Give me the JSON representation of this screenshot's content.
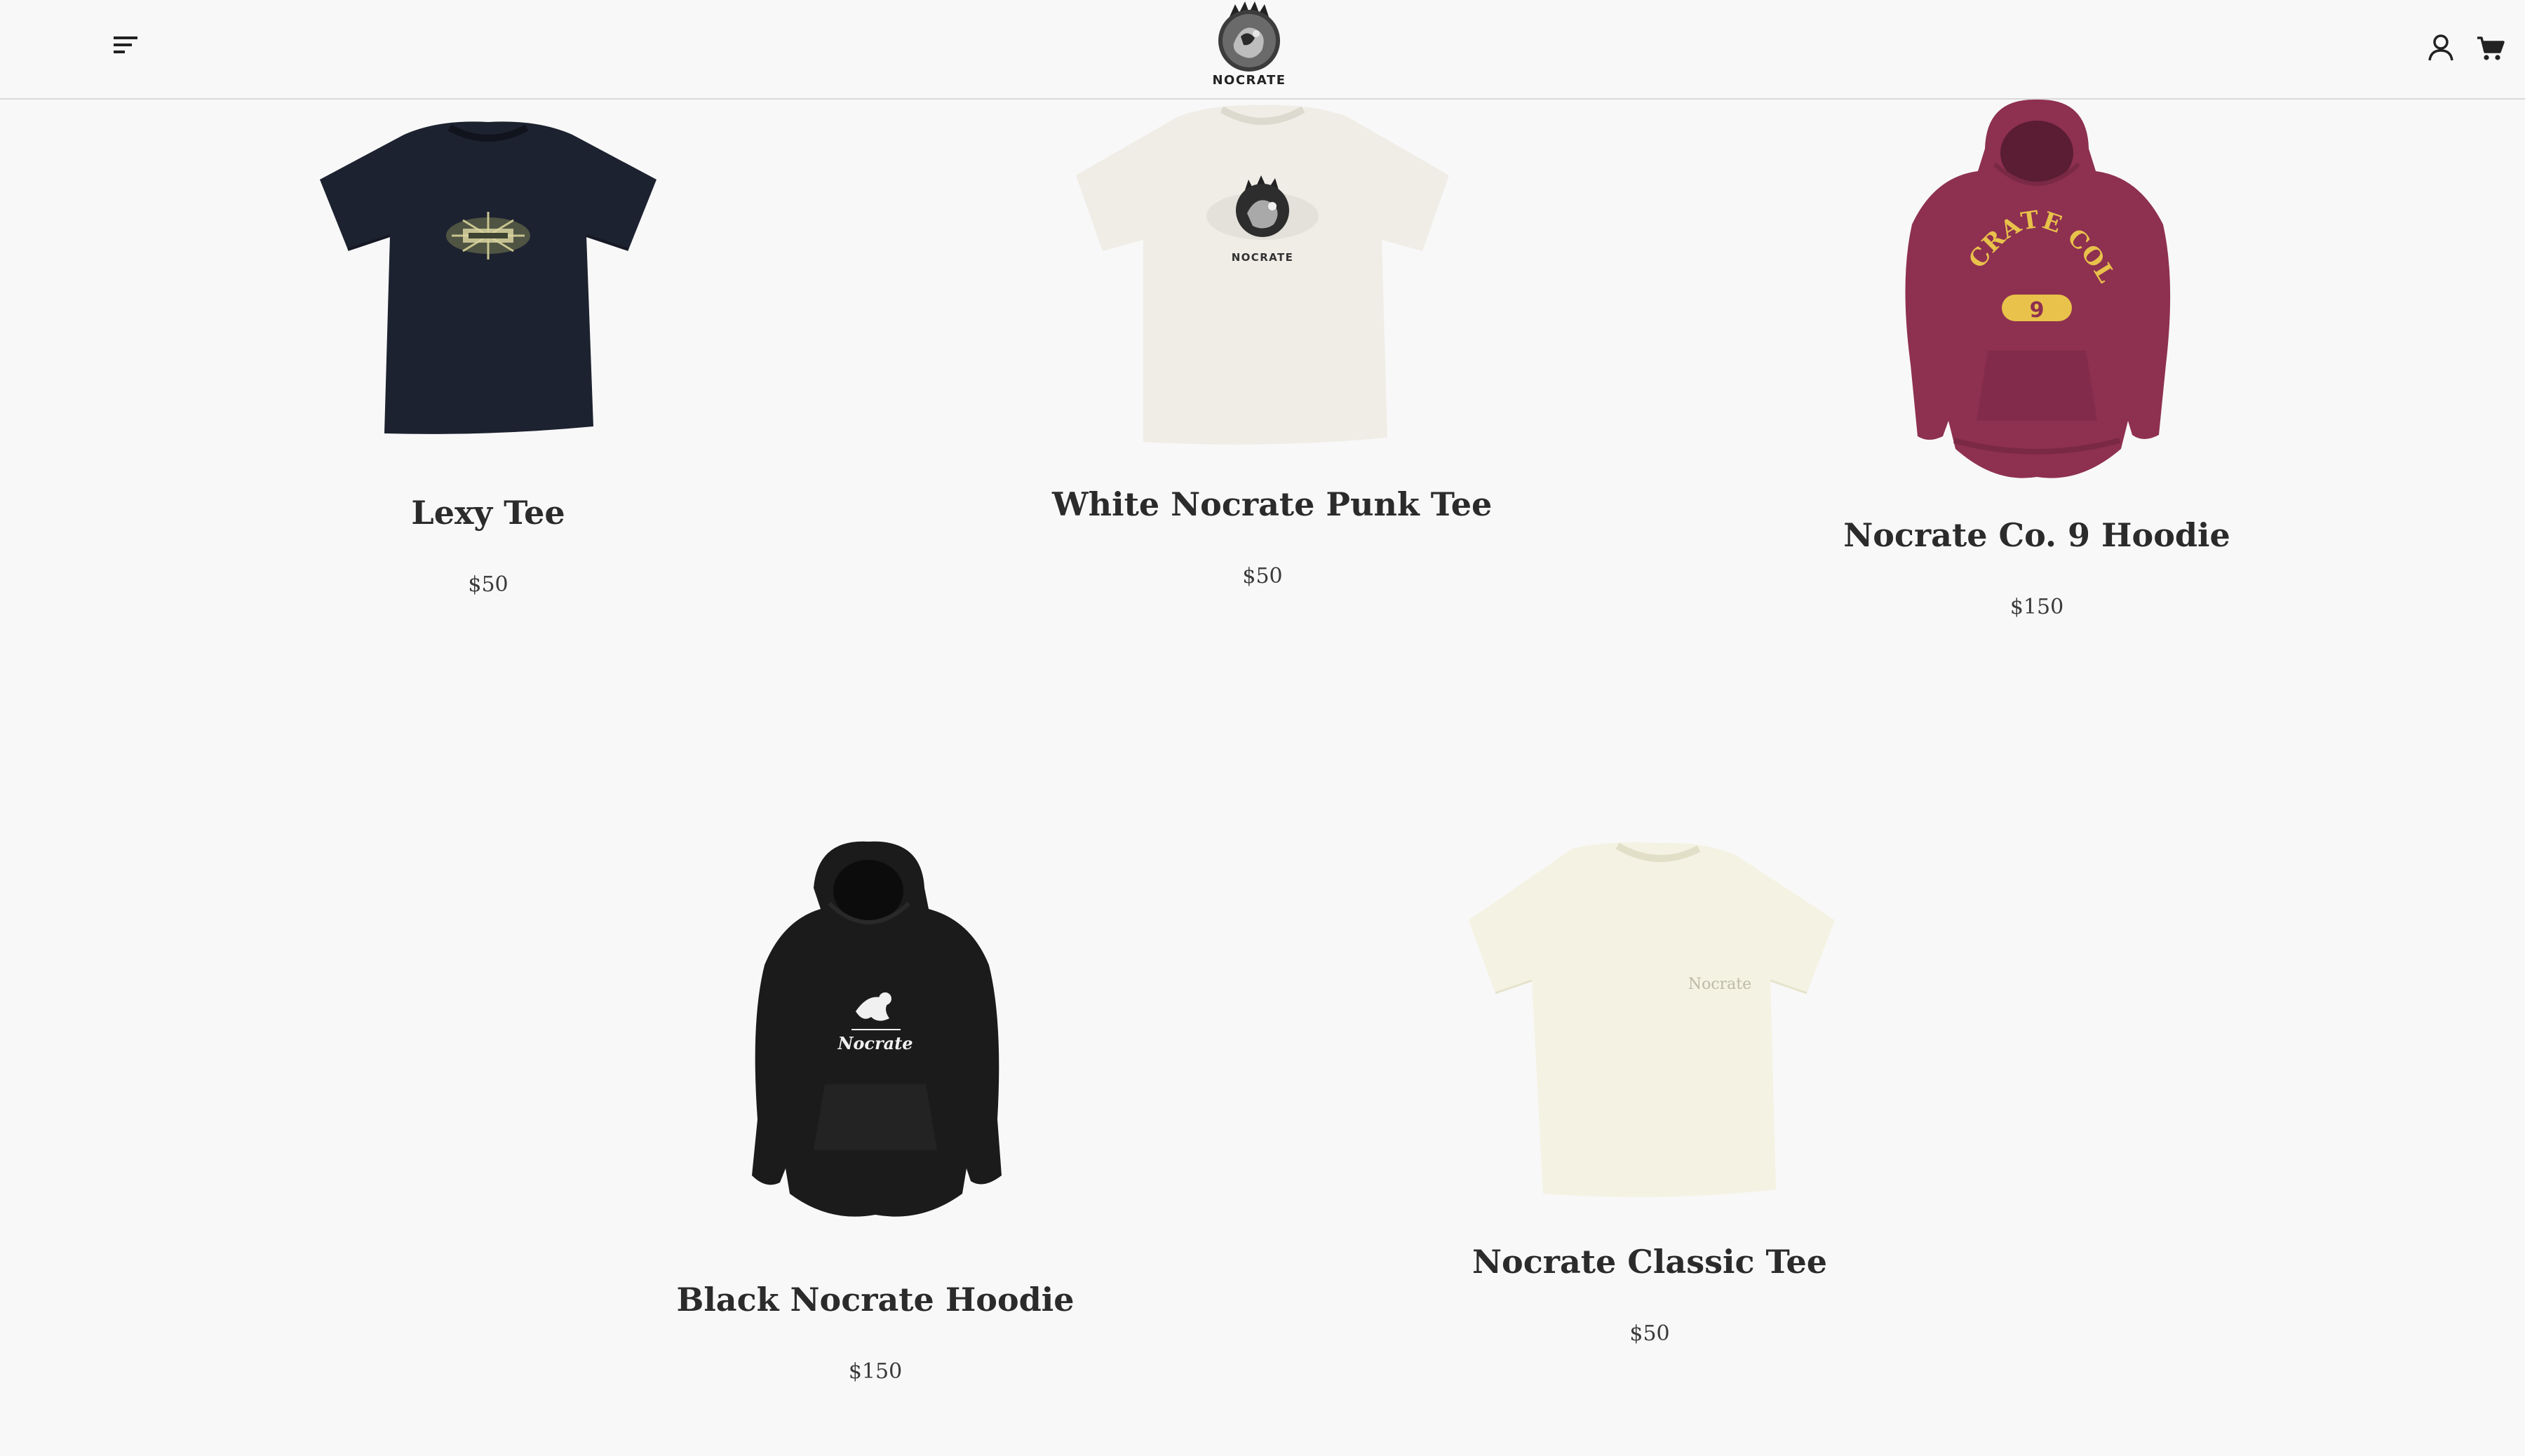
{
  "header": {
    "brand": "NOCRATE",
    "menu_icon": "menu-icon",
    "account_icon": "user-icon",
    "cart_icon": "cart-icon"
  },
  "products": [
    {
      "title": "Lexy Tee",
      "price": "$50"
    },
    {
      "title": "White Nocrate Punk Tee",
      "price": "$50"
    },
    {
      "title": "Nocrate Co. 9 Hoodie",
      "price": "$150"
    },
    {
      "title": "Black Nocrate Hoodie",
      "price": "$150"
    },
    {
      "title": "Nocrate Classic Tee",
      "price": "$50"
    }
  ],
  "print_text": {
    "punk_tee": "NOCRATE",
    "co9_arc": "NOCRATE COLL.",
    "co9_number": "9",
    "black_hoodie": "Nocrate",
    "classic_tee": "Nocrate"
  },
  "colors": {
    "background": "#f8f8f8",
    "navy_tee": "#1d2230",
    "white_tee": "#efede6",
    "maroon_hoodie": "#8e3050",
    "yellow_print": "#e8c24a",
    "black_hoodie": "#1b1b1b",
    "cream_tee": "#f4f2e2"
  }
}
